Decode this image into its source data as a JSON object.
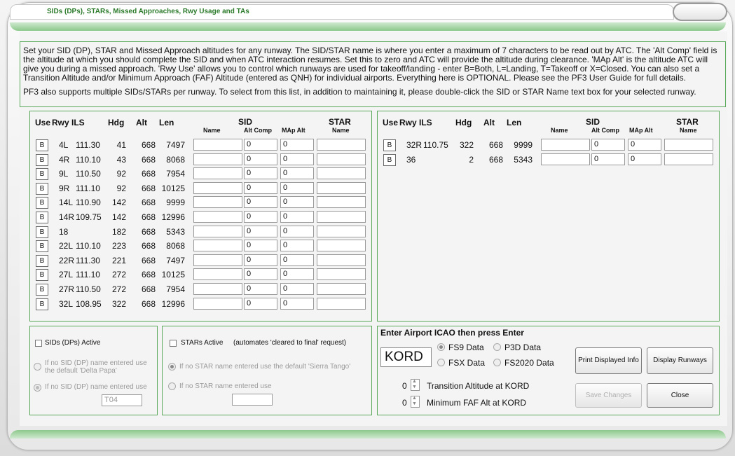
{
  "window": {
    "title": "SIDs (DPs), STARs, Missed Approaches, Rwy Usage and TAs"
  },
  "info": {
    "p1": "Set your SID (DP), STAR and Missed Approach altitudes for any runway. The SID/STAR name is where you enter a maximum of 7 characters to be read out by ATC. The 'Alt Comp' field is the altitude at which you should complete the SID and when ATC interaction resumes. Set this to zero and ATC will provide the altitude during clearance. 'MAp Alt' is the altitude ATC will give you during a missed approach. 'Rwy Use' allows you to control which runways are used for takeoff/landing - enter B=Both, L=Landing, T=Takeoff or X=Closed.  You can also set a Transition Altitude and/or Minimum Approach (FAF) Altitude (entered as QNH) for individual airports. Everything here is OPTIONAL. Please see the PF3 User Guide for full details.",
    "p2": "PF3 also supports multiple SIDs/STARs per runway. To select from this list, in addition to maintaining it, please double-click the SID or STAR Name text box for your selected runway."
  },
  "table_headers": {
    "use": "Use",
    "rwy": "Rwy",
    "ils": "ILS",
    "hdg": "Hdg",
    "alt": "Alt",
    "len": "Len",
    "sid": "SID",
    "star": "STAR",
    "name": "Name",
    "alt_comp": "Alt Comp",
    "map_alt": "MAp Alt",
    "star_name": "Name"
  },
  "runways_left": [
    {
      "use": "B",
      "rwy": "4L",
      "ils": "111.30",
      "hdg": "41",
      "alt": "668",
      "len": "7497",
      "sid_name": "",
      "alt_comp": "0",
      "map_alt": "0",
      "star_name": ""
    },
    {
      "use": "B",
      "rwy": "4R",
      "ils": "110.10",
      "hdg": "43",
      "alt": "668",
      "len": "8068",
      "sid_name": "",
      "alt_comp": "0",
      "map_alt": "0",
      "star_name": ""
    },
    {
      "use": "B",
      "rwy": "9L",
      "ils": "110.50",
      "hdg": "92",
      "alt": "668",
      "len": "7954",
      "sid_name": "",
      "alt_comp": "0",
      "map_alt": "0",
      "star_name": ""
    },
    {
      "use": "B",
      "rwy": "9R",
      "ils": "111.10",
      "hdg": "92",
      "alt": "668",
      "len": "10125",
      "sid_name": "",
      "alt_comp": "0",
      "map_alt": "0",
      "star_name": ""
    },
    {
      "use": "B",
      "rwy": "14L",
      "ils": "110.90",
      "hdg": "142",
      "alt": "668",
      "len": "9999",
      "sid_name": "",
      "alt_comp": "0",
      "map_alt": "0",
      "star_name": ""
    },
    {
      "use": "B",
      "rwy": "14R",
      "ils": "109.75",
      "hdg": "142",
      "alt": "668",
      "len": "12996",
      "sid_name": "",
      "alt_comp": "0",
      "map_alt": "0",
      "star_name": ""
    },
    {
      "use": "B",
      "rwy": "18",
      "ils": "",
      "hdg": "182",
      "alt": "668",
      "len": "5343",
      "sid_name": "",
      "alt_comp": "0",
      "map_alt": "0",
      "star_name": ""
    },
    {
      "use": "B",
      "rwy": "22L",
      "ils": "110.10",
      "hdg": "223",
      "alt": "668",
      "len": "8068",
      "sid_name": "",
      "alt_comp": "0",
      "map_alt": "0",
      "star_name": ""
    },
    {
      "use": "B",
      "rwy": "22R",
      "ils": "111.30",
      "hdg": "221",
      "alt": "668",
      "len": "7497",
      "sid_name": "",
      "alt_comp": "0",
      "map_alt": "0",
      "star_name": ""
    },
    {
      "use": "B",
      "rwy": "27L",
      "ils": "111.10",
      "hdg": "272",
      "alt": "668",
      "len": "10125",
      "sid_name": "",
      "alt_comp": "0",
      "map_alt": "0",
      "star_name": ""
    },
    {
      "use": "B",
      "rwy": "27R",
      "ils": "110.50",
      "hdg": "272",
      "alt": "668",
      "len": "7954",
      "sid_name": "",
      "alt_comp": "0",
      "map_alt": "0",
      "star_name": ""
    },
    {
      "use": "B",
      "rwy": "32L",
      "ils": "108.95",
      "hdg": "322",
      "alt": "668",
      "len": "12996",
      "sid_name": "",
      "alt_comp": "0",
      "map_alt": "0",
      "star_name": ""
    }
  ],
  "runways_right": [
    {
      "use": "B",
      "rwy": "32R",
      "ils": "110.75",
      "hdg": "322",
      "alt": "668",
      "len": "9999",
      "sid_name": "",
      "alt_comp": "0",
      "map_alt": "0",
      "star_name": ""
    },
    {
      "use": "B",
      "rwy": "36",
      "ils": "",
      "hdg": "2",
      "alt": "668",
      "len": "5343",
      "sid_name": "",
      "alt_comp": "0",
      "map_alt": "0",
      "star_name": ""
    }
  ],
  "sids_panel": {
    "active_label": "SIDs (DPs) Active",
    "default_label": "If no SID (DP) name entered use the default 'Delta Papa'",
    "use_label": "If no SID (DP) name entered use",
    "use_value": "T04"
  },
  "stars_panel": {
    "active_label": "STARs Active",
    "note": "(automates 'cleared to final' request)",
    "default_label": "If no STAR name entered use the default 'Sierra Tango'",
    "use_label": "If no STAR name entered use",
    "use_value": ""
  },
  "airport_panel": {
    "title": "Enter Airport ICAO then press Enter",
    "icao": "KORD",
    "fs9": "FS9 Data",
    "p3d": "P3D Data",
    "fsx": "FSX Data",
    "fs2020": "FS2020 Data",
    "ta_value": "0",
    "ta_label": "Transition Altitude at KORD",
    "faf_value": "0",
    "faf_label": "Minimum FAF Alt at KORD",
    "print_btn": "Print Displayed Info",
    "display_btn": "Display Runways",
    "save_btn": "Save Changes",
    "close_btn": "Close"
  }
}
